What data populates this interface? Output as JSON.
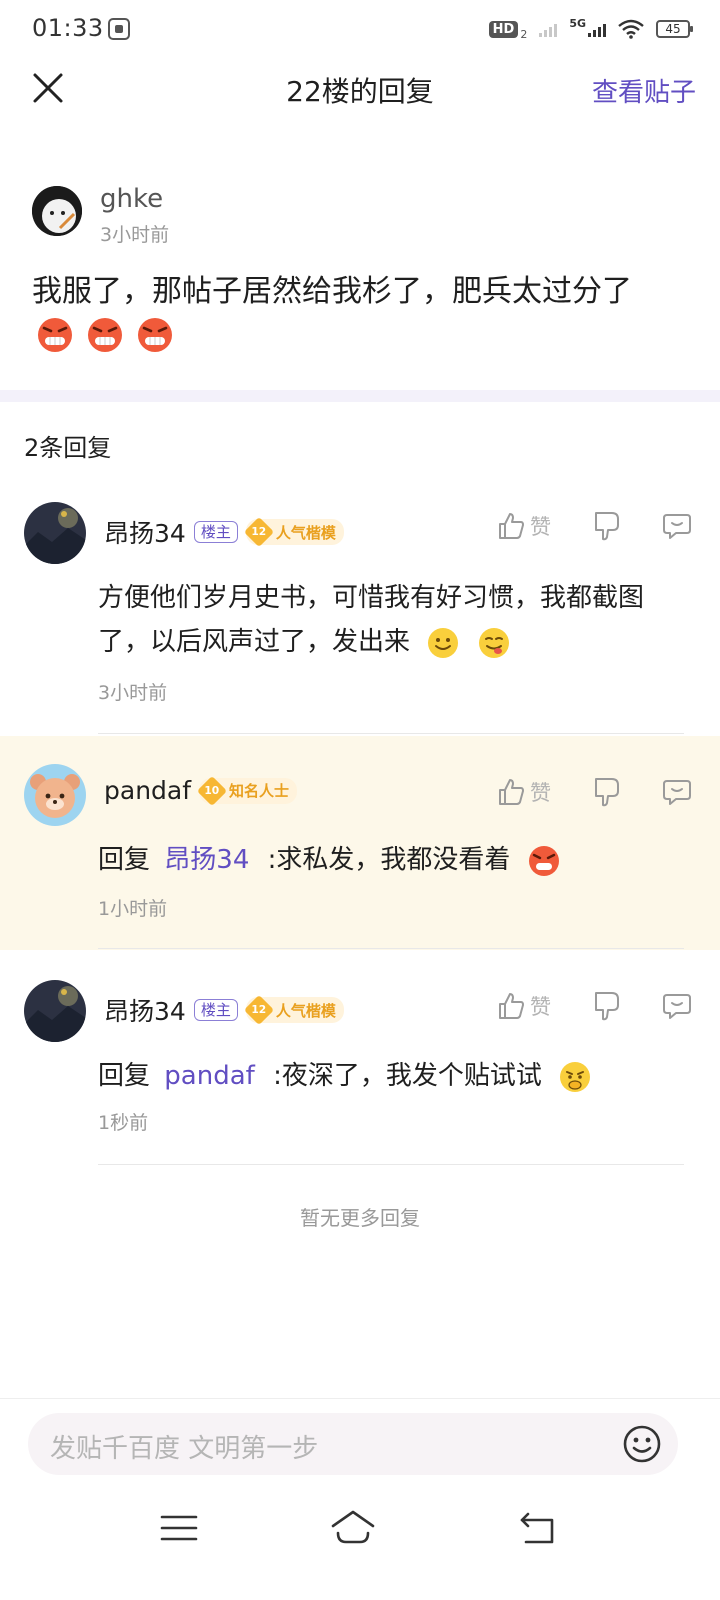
{
  "status_bar": {
    "time": "01:33",
    "network": "5G",
    "hd": "HD",
    "hd_sub": "2",
    "battery": "45"
  },
  "header": {
    "title": "22楼的回复",
    "view_post": "查看贴子"
  },
  "main_post": {
    "author": "ghke",
    "time": "3小时前",
    "content": "我服了，那帖子居然给我杉了，肥兵太过分了",
    "emojis": [
      "angry-emoji",
      "angry-emoji",
      "angry-emoji"
    ]
  },
  "replies": {
    "count_label": "2条回复",
    "items": [
      {
        "author": "昂扬34",
        "owner_badge": "楼主",
        "level": "12",
        "title_tag": "人气楷模",
        "like_label": "赞",
        "content": "方便他们岁月史书，可惜我有好习惯，我都截图了，以后风声过了，发出来",
        "emojis": [
          "smile-emoji",
          "yummy-emoji"
        ],
        "time": "3小时前"
      },
      {
        "author": "pandaf",
        "level": "10",
        "title_tag": "知名人士",
        "like_label": "赞",
        "reply_prefix": "回复",
        "mention": "昂扬34",
        "content": ":求私发，我都没看着",
        "emojis": [
          "angry-emoji"
        ],
        "time": "1小时前"
      },
      {
        "author": "昂扬34",
        "owner_badge": "楼主",
        "level": "12",
        "title_tag": "人气楷模",
        "like_label": "赞",
        "reply_prefix": "回复",
        "mention": "pandaf",
        "content": ":夜深了，我发个贴试试",
        "emojis": [
          "thinking-emoji"
        ],
        "time": "1秒前"
      }
    ],
    "no_more": "暂无更多回复"
  },
  "input": {
    "placeholder": "发贴千百度 文明第一步"
  },
  "colors": {
    "accent": "#614ec2",
    "highlight_bg": "#fdf8e9",
    "level_gold": "#f7b733"
  }
}
